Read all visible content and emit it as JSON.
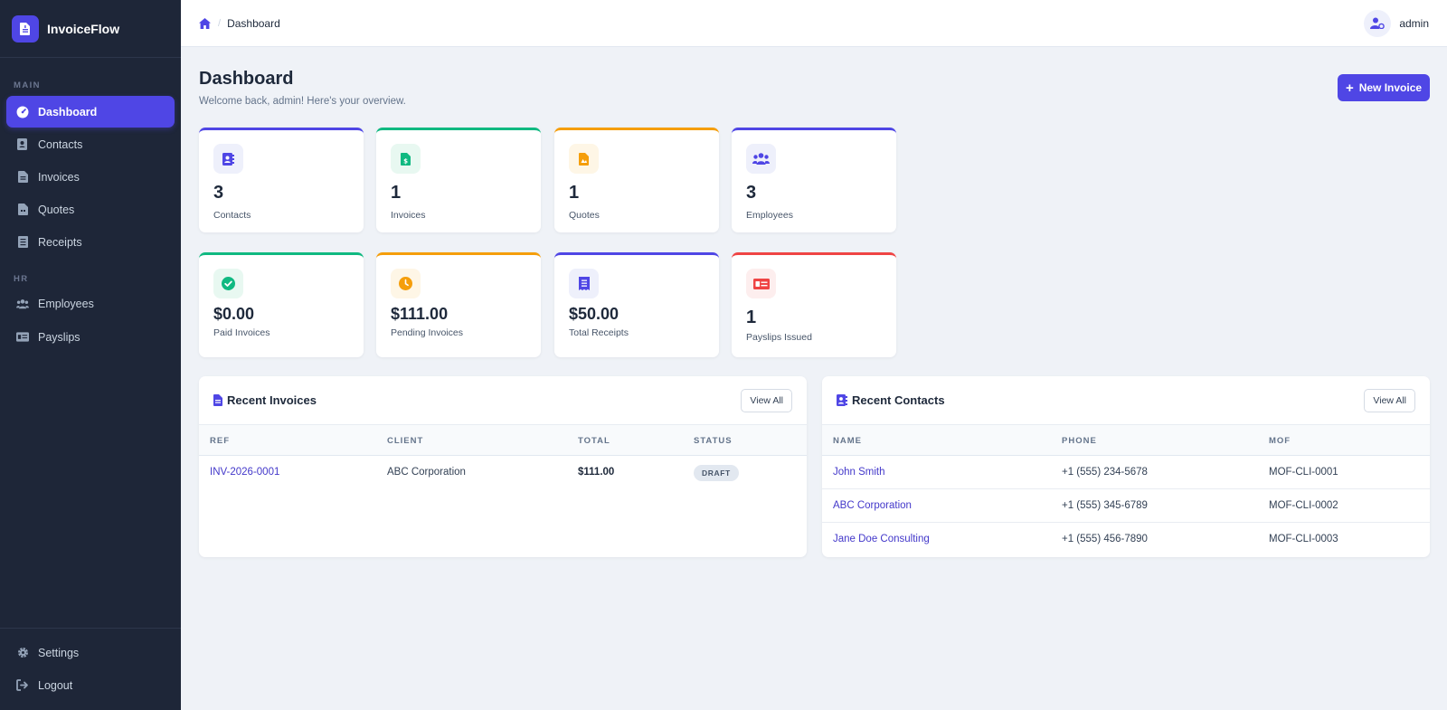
{
  "app": {
    "name": "InvoiceFlow",
    "logo_icon": "file-invoice-icon",
    "accent": "#4f46e5"
  },
  "sidebar": {
    "sections": [
      {
        "title": "MAIN"
      },
      {
        "title": "HR"
      }
    ],
    "items": [
      {
        "label": "Dashboard",
        "icon": "dashboard-gauge-icon",
        "active": true
      },
      {
        "label": "Contacts",
        "icon": "address-book-icon"
      },
      {
        "label": "Invoices",
        "icon": "file-invoice-icon"
      },
      {
        "label": "Quotes",
        "icon": "file-quote-icon"
      },
      {
        "label": "Receipts",
        "icon": "receipt-icon"
      },
      {
        "label": "Employees",
        "icon": "users-icon"
      },
      {
        "label": "Payslips",
        "icon": "money-check-icon"
      }
    ],
    "footer": [
      {
        "label": "Settings",
        "icon": "gear-icon"
      },
      {
        "label": "Logout",
        "icon": "logout-icon"
      }
    ]
  },
  "topbar": {
    "breadcrumb": {
      "home_icon": "home-icon",
      "separator": "/",
      "current": "Dashboard"
    },
    "user": {
      "name": "admin",
      "icon": "user-gear-icon"
    }
  },
  "header": {
    "title": "Dashboard",
    "subtitle": "Welcome back, admin! Here's your overview.",
    "new_invoice_label": "New Invoice",
    "new_invoice_icon": "plus-icon"
  },
  "stats": [
    {
      "value": "3",
      "label": "Contacts",
      "color": "#4f46e5",
      "icon": "address-book-icon"
    },
    {
      "value": "1",
      "label": "Invoices",
      "color": "#10b981",
      "icon": "file-invoice-dollar-icon"
    },
    {
      "value": "1",
      "label": "Quotes",
      "color": "#f59e0b",
      "icon": "file-quote-icon"
    },
    {
      "value": "3",
      "label": "Employees",
      "color": "#4f46e5",
      "icon": "users-icon"
    },
    {
      "value": "$0.00",
      "label": "Paid Invoices",
      "color": "#10b981",
      "icon": "check-circle-icon"
    },
    {
      "value": "$111.00",
      "label": "Pending Invoices",
      "color": "#f59e0b",
      "icon": "clock-icon"
    },
    {
      "value": "$50.00",
      "label": "Total Receipts",
      "color": "#4f46e5",
      "icon": "receipt-icon"
    },
    {
      "value": "1",
      "label": "Payslips Issued",
      "color": "#ef4444",
      "icon": "money-check-icon"
    }
  ],
  "recent_invoices": {
    "title": "Recent Invoices",
    "view_all": "View All",
    "columns": [
      "REF",
      "CLIENT",
      "TOTAL",
      "STATUS"
    ],
    "rows": [
      {
        "ref": "INV-2026-0001",
        "client": "ABC Corporation",
        "total": "$111.00",
        "status": "DRAFT"
      }
    ]
  },
  "recent_contacts": {
    "title": "Recent Contacts",
    "view_all": "View All",
    "columns": [
      "NAME",
      "PHONE",
      "MOF"
    ],
    "rows": [
      {
        "name": "John Smith",
        "phone": "+1 (555) 234-5678",
        "mof": "MOF-CLI-0001"
      },
      {
        "name": "ABC Corporation",
        "phone": "+1 (555) 345-6789",
        "mof": "MOF-CLI-0002"
      },
      {
        "name": "Jane Doe Consulting",
        "phone": "+1 (555) 456-7890",
        "mof": "MOF-CLI-0003"
      }
    ]
  }
}
